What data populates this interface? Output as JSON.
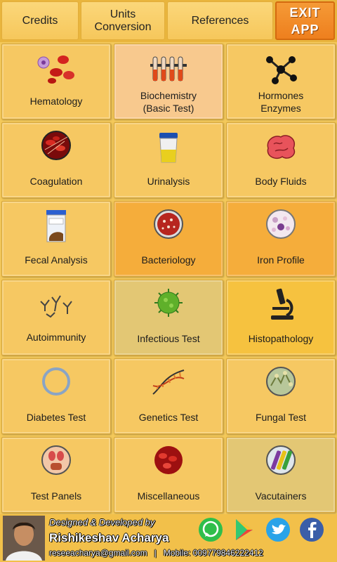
{
  "topbar": {
    "credits": "Credits",
    "units": "Units\nConversion",
    "references": "References",
    "exit": "EXIT\nAPP"
  },
  "tiles": [
    {
      "label": "Hematology",
      "icon": "blood-cells-icon"
    },
    {
      "label": "Biochemistry\n(Basic Test)",
      "icon": "test-tubes-icon"
    },
    {
      "label": "Hormones\nEnzymes",
      "icon": "molecule-icon"
    },
    {
      "label": "Coagulation",
      "icon": "clot-icon"
    },
    {
      "label": "Urinalysis",
      "icon": "urine-cup-icon"
    },
    {
      "label": "Body Fluids",
      "icon": "brain-icon"
    },
    {
      "label": "Fecal Analysis",
      "icon": "stool-container-icon"
    },
    {
      "label": "Bacteriology",
      "icon": "petri-dish-icon"
    },
    {
      "label": "Iron Profile",
      "icon": "blood-smear-icon"
    },
    {
      "label": "Autoimmunity",
      "icon": "antibodies-icon"
    },
    {
      "label": "Infectious Test",
      "icon": "virus-icon"
    },
    {
      "label": "Histopathology",
      "icon": "microscope-icon"
    },
    {
      "label": "Diabetes Test",
      "icon": "diabetes-ring-icon"
    },
    {
      "label": "Genetics Test",
      "icon": "dna-icon"
    },
    {
      "label": "Fungal Test",
      "icon": "fungus-icon"
    },
    {
      "label": "Test Panels",
      "icon": "anatomy-icon"
    },
    {
      "label": "Miscellaneous",
      "icon": "rbc-sphere-icon"
    },
    {
      "label": "Vacutainers",
      "icon": "vacutainer-icon"
    }
  ],
  "footer": {
    "designed_by": "Designed & Developed by",
    "name": "Rishikeshav Acharya",
    "contact": "reseeacharya@gmail.com   |   Mobile: 009779846222412"
  },
  "social": [
    "whatsapp-icon",
    "play-store-icon",
    "twitter-icon",
    "facebook-icon"
  ],
  "colors": {
    "background": "#f4c95a",
    "tile": "#f6c862",
    "tile_peach": "#f8c98e",
    "tile_orange": "#f5ad3b",
    "tile_olive": "#e3c774",
    "exit_button": "#ee7f1e"
  }
}
